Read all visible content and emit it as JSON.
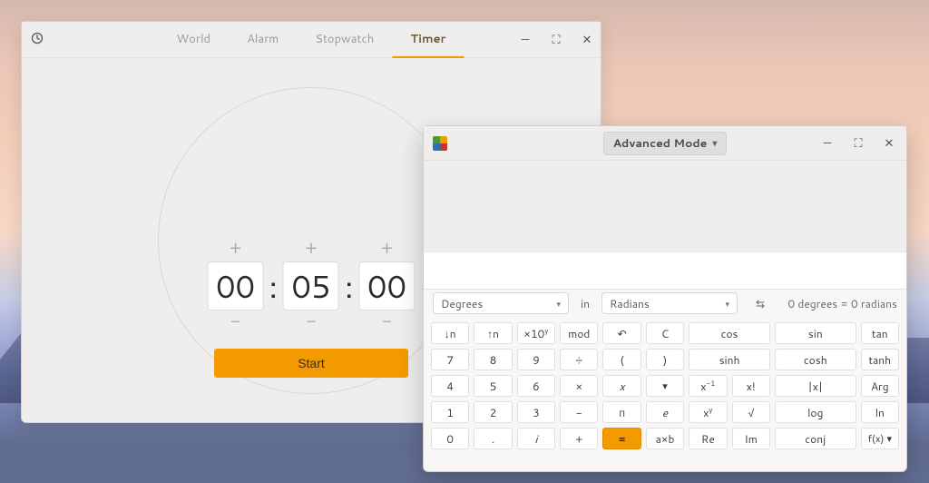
{
  "clocks": {
    "tabs": [
      "World",
      "Alarm",
      "Stopwatch",
      "Timer"
    ],
    "active_tab_index": 3,
    "timer": {
      "hours": "00",
      "minutes": "05",
      "seconds": "00"
    },
    "start_label": "Start",
    "plus": "+",
    "minus": "−",
    "colon": ":"
  },
  "calc": {
    "mode_label": "Advanced Mode",
    "conv": {
      "from": "Degrees",
      "in_label": "in",
      "to": "Radians",
      "swap_glyph": "⇆",
      "result": "0 degrees  =  0 radians"
    },
    "rows": [
      [
        {
          "id": "key-shift-down",
          "label": "↓n"
        },
        {
          "id": "key-shift-up",
          "label": "↑n"
        },
        {
          "id": "key-sci",
          "html": "×10<span class=\"sup\">y</span>"
        },
        {
          "id": "key-mod",
          "label": "mod"
        },
        {
          "id": "key-undo",
          "label": "↶"
        },
        {
          "id": "key-clear",
          "label": "C"
        },
        {
          "id": "key-cos",
          "label": "cos"
        },
        {
          "id": "key-cos",
          "label": "",
          "skip": true
        },
        {
          "id": "key-sin",
          "label": "sin"
        },
        {
          "id": "key-sin",
          "label": "",
          "skip": true
        },
        {
          "id": "key-tan",
          "label": "tan"
        }
      ],
      [
        {
          "id": "key-7",
          "label": "7"
        },
        {
          "id": "key-8",
          "label": "8"
        },
        {
          "id": "key-9",
          "label": "9"
        },
        {
          "id": "key-div",
          "label": "÷"
        },
        {
          "id": "key-lparen",
          "label": "("
        },
        {
          "id": "key-rparen",
          "label": ")"
        },
        {
          "id": "key-sinh",
          "label": "sinh"
        },
        {
          "id": "key-sinh",
          "label": "",
          "skip": true
        },
        {
          "id": "key-cosh",
          "label": "cosh"
        },
        {
          "id": "key-cosh",
          "label": "",
          "skip": true
        },
        {
          "id": "key-tanh",
          "label": "tanh"
        }
      ],
      [
        {
          "id": "key-4",
          "label": "4"
        },
        {
          "id": "key-5",
          "label": "5"
        },
        {
          "id": "key-6",
          "label": "6"
        },
        {
          "id": "key-mul",
          "label": "×"
        },
        {
          "id": "key-x",
          "label": "x",
          "style": "italic"
        },
        {
          "id": "key-dropdown",
          "label": "▾",
          "cls": "small"
        },
        {
          "id": "key-xinv",
          "html": "x<span class=\"sup\">-1</span>"
        },
        {
          "id": "key-fact",
          "label": "x!"
        },
        {
          "id": "key-abs",
          "label": "|x|"
        },
        {
          "id": "key-abs",
          "label": "",
          "skip": true
        },
        {
          "id": "key-arg",
          "label": "Arg"
        }
      ],
      [
        {
          "id": "key-1",
          "label": "1"
        },
        {
          "id": "key-2",
          "label": "2"
        },
        {
          "id": "key-3",
          "label": "3"
        },
        {
          "id": "key-minus",
          "label": "−"
        },
        {
          "id": "key-pi",
          "label": "π"
        },
        {
          "id": "key-e",
          "label": "e",
          "style": "italic"
        },
        {
          "id": "key-xy",
          "html": "x<span class=\"sup\">y</span>"
        },
        {
          "id": "key-sqrt",
          "label": "√"
        },
        {
          "id": "key-log",
          "label": "log"
        },
        {
          "id": "key-log",
          "label": "",
          "skip": true
        },
        {
          "id": "key-ln",
          "label": "ln"
        }
      ],
      [
        {
          "id": "key-0",
          "label": "0"
        },
        {
          "id": "key-dot",
          "label": "."
        },
        {
          "id": "key-i",
          "label": "i",
          "style": "italic"
        },
        {
          "id": "key-plus",
          "label": "+"
        },
        {
          "id": "key-equals",
          "label": "=",
          "cls": "accent"
        },
        {
          "id": "key-axb",
          "label": "a×b"
        },
        {
          "id": "key-re",
          "label": "Re"
        },
        {
          "id": "key-im",
          "label": "Im"
        },
        {
          "id": "key-conj",
          "label": "conj"
        },
        {
          "id": "key-conj",
          "label": "",
          "skip": true
        },
        {
          "id": "key-fx",
          "label": "f(x) ▾",
          "cls": "small"
        }
      ]
    ],
    "row_span_map": [
      [
        1,
        1,
        1,
        1,
        1,
        1,
        2,
        0,
        2,
        0,
        1
      ],
      [
        1,
        1,
        1,
        1,
        1,
        1,
        2,
        0,
        2,
        0,
        1
      ],
      [
        1,
        1,
        1,
        1,
        1,
        1,
        1,
        1,
        2,
        0,
        1
      ],
      [
        1,
        1,
        1,
        1,
        1,
        1,
        1,
        1,
        2,
        0,
        1
      ],
      [
        1,
        1,
        1,
        1,
        1,
        1,
        1,
        1,
        2,
        0,
        1
      ]
    ]
  }
}
